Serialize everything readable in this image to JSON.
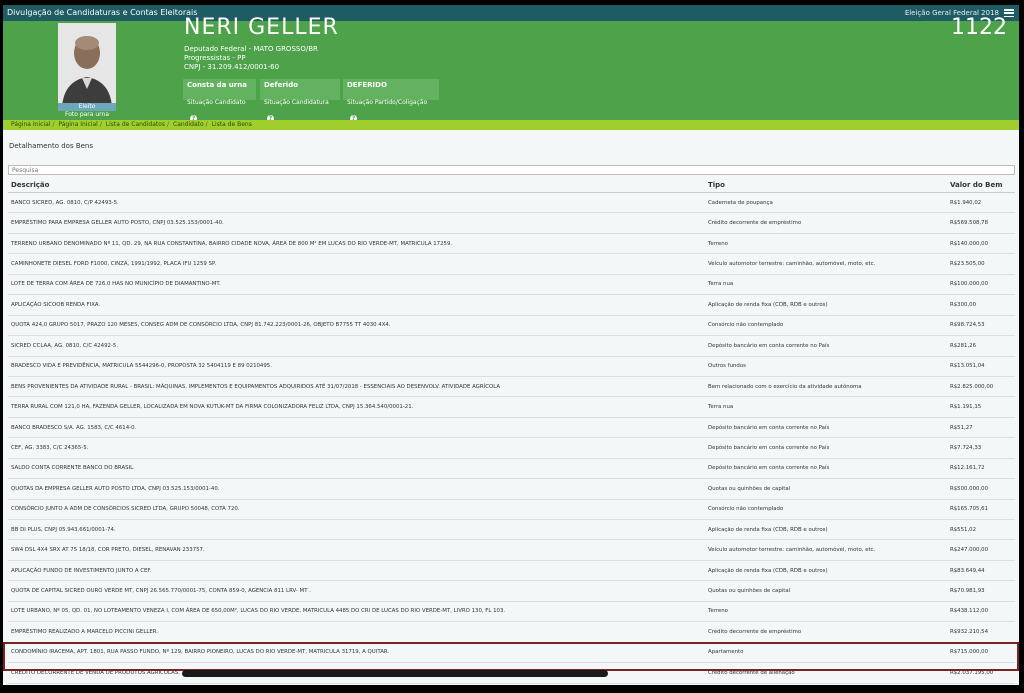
{
  "topbar": {
    "app_title": "Divulgação de Candidaturas e Contas Eleitorais",
    "election": "Eleição Geral Federal 2018",
    "menu_icon": "hamburger-icon"
  },
  "candidate": {
    "name": "NERI GELLER",
    "number": "1122",
    "office": "Deputado Federal - MATO GROSSO/BR",
    "party": "Progressistas - PP",
    "cnpj": "CNPJ - 31.209.412/0001-60",
    "elected_label": "Eleito",
    "photo_caption": "Foto para urna"
  },
  "badges": [
    {
      "title": "Consta da urna",
      "subtitle": "Situação Candidato"
    },
    {
      "title": "Deferido",
      "subtitle": "Situação Candidatura"
    },
    {
      "title": "DEFERIDO",
      "subtitle": "Situação Partido/Coligação"
    }
  ],
  "breadcrumb": [
    "Página Inicial",
    "Página Inicial",
    "Lista de Candidatos",
    "Candidato",
    "Lista de Bens"
  ],
  "section_title": "Detalhamento dos Bens",
  "search": {
    "placeholder": "Pesquisa"
  },
  "table": {
    "headers": [
      "Descrição",
      "Tipo",
      "Valor do Bem"
    ],
    "rows": [
      [
        "BANCO SICRED, AG. 0810, C/P 42493-5.",
        "Caderneta de poupança",
        "R$1.940,02"
      ],
      [
        "EMPRÉSTIMO PARA EMPRESA GELLER AUTO POSTO, CNPJ 03.525.153/0001-40.",
        "Crédito decorrente de empréstimo",
        "R$569.508,78"
      ],
      [
        "TERRENO URBANO DENOMINADO Nº 11, QD. 29, NA RUA CONSTANTINA, BAIRRO CIDADE NOVA, ÁREA DE 800 M² EM LUCAS DO RIO VERDE-MT, MATRICULA 17259.",
        "Terreno",
        "R$140.000,00"
      ],
      [
        "CAMINHONETE DIESEL FORD F1000, CINZA, 1991/1992, PLACA IFU 1259 SP.",
        "Veículo automotor terrestre: caminhão, automóvel, moto, etc.",
        "R$23.505,00"
      ],
      [
        "LOTE DE TERRA COM ÁREA DE 726.0 HAS NO MUNICÍPIO DE DIAMANTINO-MT.",
        "Terra nua",
        "R$100.000,00"
      ],
      [
        "APLICAÇÃO SICOOB RENDA FIXA.",
        "Aplicação de renda fixa (CDB, RDB e outros)",
        "R$300,00"
      ],
      [
        "QUOTA 424,0 GRUPO 5017, PRAZO 120 MESES, CONSEG ADM DE CONSÓRCIO LTDA, CNPJ 81.742.223/0001-26, OBJETO B7755 TT 4030 4X4.",
        "Consórcio não contemplado",
        "R$98.724,53"
      ],
      [
        "SICRED CCLAA, AG. 0810, C/C 42492-5.",
        "Depósito bancário em conta corrente no País",
        "R$281,26"
      ],
      [
        "BRADESCO VIDA E PREVIDÊNCIA, MATRICULA 5544296-0, PROPOSTA 32 5404119 E 89 0210495.",
        "Outros fundos",
        "R$13.051,04"
      ],
      [
        "BENS PROVENIENTES DA ATIVIDADE RURAL - BRASIL: MÁQUINAS, IMPLEMENTOS E EQUIPAMENTOS ADQUIRIDOS ATÉ 31/07/2018 - ESSENCIAIS AO DESENVOLV. ATIVIDADE AGRÍCOLA",
        "Bem relacionado com o exercício da atividade autônoma",
        "R$2.825.000,00"
      ],
      [
        "TERRA RURAL COM 121,0 HA, FAZENDA GELLER, LOCALIZADA EM NOVA KUTUK-MT DA FIRMA COLONIZADORA FELIZ LTDA, CNPJ 15.364.540/0001-21.",
        "Terra nua",
        "R$1.191,15"
      ],
      [
        "BANCO BRADESCO S/A. AG. 1583, C/C 4614-0.",
        "Depósito bancário em conta corrente no País",
        "R$51,27"
      ],
      [
        "CEF, AG. 3383, C/C 24365-5.",
        "Depósito bancário em conta corrente no País",
        "R$7.724,33"
      ],
      [
        "SALDO CONTA CORRENTE BANCO DO BRASIL.",
        "Depósito bancário em conta corrente no País",
        "R$12.161,72"
      ],
      [
        "QUOTAS DA EMPRESA GELLER AUTO POSTO LTDA, CNPJ 03.525.153/0001-40.",
        "Quotas ou quinhões de capital",
        "R$500.000,00"
      ],
      [
        "CONSÓRCIO JUNTO A ADM DE CONSÓRCIOS SICRED LTDA, GRUPO 50048, COTA 720.",
        "Consórcio não contemplado",
        "R$165.705,61"
      ],
      [
        "BB DI PLUS, CNPJ 05.943.661/0001-74.",
        "Aplicação de renda fixa (CDB, RDB e outros)",
        "R$551,02"
      ],
      [
        "SW4 DSL 4X4 SRX AT 75 18/18, COR PRETO, DIESEL, RENAVAN 233757.",
        "Veículo automotor terrestre: caminhão, automóvel, moto, etc.",
        "R$247.000,00"
      ],
      [
        "APLICAÇÃO FUNDO DE INVESTIMENTO JUNTO A CEF.",
        "Aplicação de renda fixa (CDB, RDB e outros)",
        "R$83.649,44"
      ],
      [
        "QUOTA DE CAPITAL SICRED OURO VERDE MT, CNPJ 26.565.770/0001-75, CONTA 859-0, AGENCIA 811 LRV- MT .",
        "Quotas ou quinhões de capital",
        "R$70.981,93"
      ],
      [
        "LOTE URBANO, Nº 05, QD. 01, NO LOTEAMENTO VENEZA I, COM ÁREA DE 650,00M², LUCAS DO RIO VERDE, MATRICULA 4485 DO CRI DE LUCAS DO RIO VERDE-MT, LIVRO 130, FL 103.",
        "Terreno",
        "R$438.112,00"
      ],
      [
        "EMPRÉSTIMO REALIZADO A MARCELO PICCINI GELLER.",
        "Crédito decorrente de empréstimo",
        "R$932.210,54"
      ],
      [
        "CONDOMÍNIO IRACEMA, APT. 1801, RUA PASSO FUNDO, Nº 129, BAIRRO PIONEIRO, LUCAS DO RIO VERDE-MT, MATRICULA 31719, A QUITAR.",
        "Apartamento",
        "R$715.000,00"
      ],
      [
        "CRÉDITO DECORRENTE DE VENDA DE PRODUTOS AGRÍCOLAS.",
        "Crédito decorrente de alienação",
        "R$2.037.195,00"
      ]
    ]
  },
  "colors": {
    "topbar": "#1e5b63",
    "header_green": "#4da24a",
    "breadcrumb_bg": "#9fce2d",
    "highlight_border": "#7a2323"
  }
}
